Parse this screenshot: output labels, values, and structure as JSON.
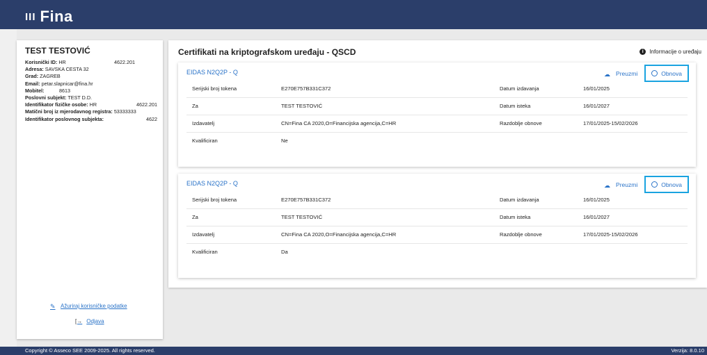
{
  "brand": {
    "name": "Fina",
    "bars": "III"
  },
  "user": {
    "name": "TEST TESTOVIĆ",
    "fields": [
      {
        "label": "Korisnički ID:",
        "value": "HR",
        "right": "4622.201"
      },
      {
        "label": "Adresa:",
        "value": "SAVSKA CESTA 32",
        "right": ""
      },
      {
        "label": "Grad:",
        "value": "ZAGREB",
        "right": ""
      },
      {
        "label": "Email:",
        "value": "petar.slapnicar@fina.hr",
        "right": ""
      },
      {
        "label": "Mobitel:",
        "value": "8613",
        "right": ""
      },
      {
        "label": "Poslovni subjekt:",
        "value": "TEST D.D.",
        "right": ""
      },
      {
        "label": "Identifikator fizičke osobe:",
        "value": "HR",
        "right": "4622.201"
      },
      {
        "label": "Matični broj iz mjerodavnog registra:",
        "value": "53333333",
        "right": ""
      },
      {
        "label": "Identifikator poslovnog subjekta:",
        "value": "",
        "right": "4622"
      }
    ],
    "edit_label": "Ažuriraj korisničke podatke",
    "logout_label": "Odjava"
  },
  "main": {
    "title": "Certifikati na kriptografskom uređaju - QSCD",
    "device_info_label": "Informacije o uređaju",
    "download_label": "Preuzmi",
    "renew_label": "Obnova",
    "certificates": [
      {
        "name": "EIDAS N2Q2P - Q",
        "rows": [
          {
            "l1": "Serijski broj tokena",
            "v1": "E270E757B331C372",
            "l2": "Datum izdavanja",
            "v2": "16/01/2025"
          },
          {
            "l1": "Za",
            "v1": "TEST TESTOVIĆ",
            "l2": "Datum isteka",
            "v2": "16/01/2027"
          },
          {
            "l1": "Izdavatelj",
            "v1": "CN=Fina CA 2020,O=Financijska agencija,C=HR",
            "l2": "Razdoblje obnove",
            "v2": "17/01/2025-15/02/2026"
          },
          {
            "l1": "Kvalificiran",
            "v1": "Ne",
            "l2": "",
            "v2": ""
          }
        ]
      },
      {
        "name": "EIDAS N2Q2P - Q",
        "rows": [
          {
            "l1": "Serijski broj tokena",
            "v1": "E270E757B331C372",
            "l2": "Datum izdavanja",
            "v2": "16/01/2025"
          },
          {
            "l1": "Za",
            "v1": "TEST TESTOVIĆ",
            "l2": "Datum isteka",
            "v2": "16/01/2027"
          },
          {
            "l1": "Izdavatelj",
            "v1": "CN=Fina CA 2020,O=Financijska agencija,C=HR",
            "l2": "Razdoblje obnove",
            "v2": "17/01/2025-15/02/2026"
          },
          {
            "l1": "Kvalificiran",
            "v1": "Da",
            "l2": "",
            "v2": ""
          }
        ]
      }
    ]
  },
  "footer": {
    "copyright": "Copyright © Asseco SEE 2009-2025. All rights reserved.",
    "version": "Verzija: 8.0.10"
  }
}
